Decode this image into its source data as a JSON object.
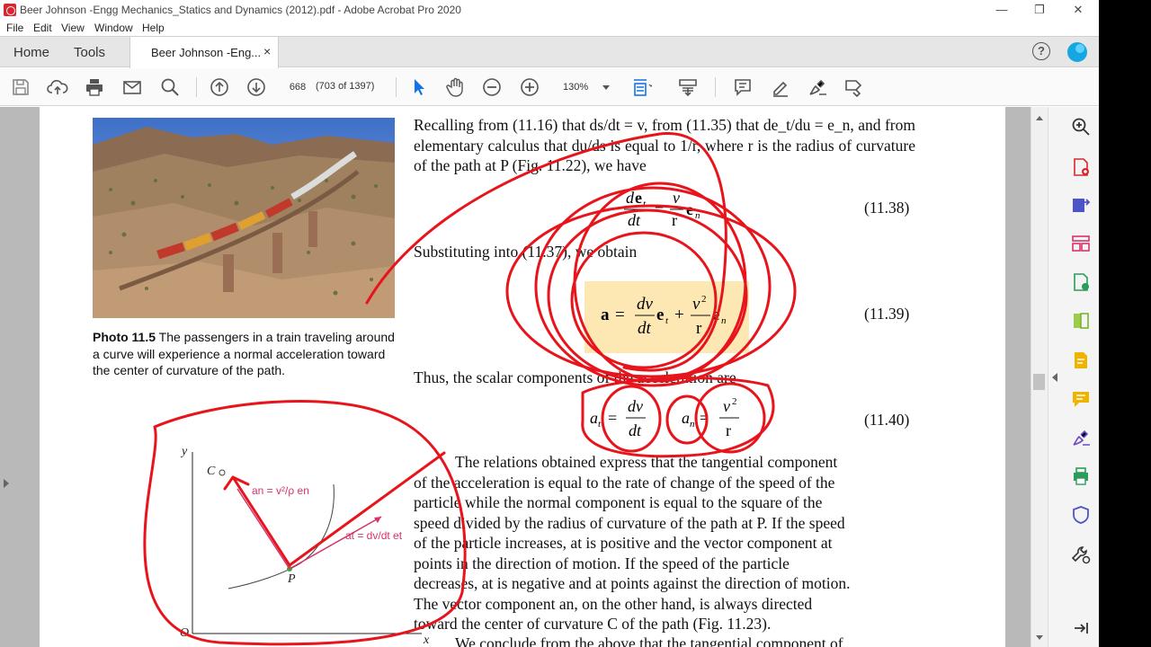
{
  "window": {
    "title": "Beer Johnson -Engg Mechanics_Statics and Dynamics (2012).pdf - Adobe Acrobat Pro 2020",
    "minimize": "—",
    "maximize": "❐",
    "close": "✕"
  },
  "menu": [
    "File",
    "Edit",
    "View",
    "Window",
    "Help"
  ],
  "tabs": {
    "home": "Home",
    "tools": "Tools",
    "document": "Beer Johnson -Eng...",
    "close": "×"
  },
  "toolbar": {
    "page_number": "668",
    "page_count": "(703 of 1397)",
    "zoom": "130%",
    "icons": [
      "save-icon",
      "upload-icon",
      "print-icon",
      "email-icon",
      "search-icon",
      "previous-page-icon",
      "next-page-icon",
      "zoom-out-icon",
      "zoom-in-icon",
      "select-cursor-icon",
      "hand-tool-icon",
      "fit-page-icon",
      "scroll-mode-icon",
      "comment-icon",
      "highlight-pen-icon",
      "sign-icon",
      "redact-icon"
    ]
  },
  "right_pane_icons": [
    "zoom-icon",
    "create-pdf-icon",
    "export-pdf-icon",
    "organize-pages-icon",
    "edit-pdf-icon",
    "combine-files-icon",
    "create-pdf-alt-icon",
    "comment-icon",
    "fill-sign-icon",
    "print-production-icon",
    "protect-icon",
    "more-tools-icon",
    "expand-icon"
  ],
  "page": {
    "caption_bold": "Photo 11.5",
    "caption_text": "The passengers in a train traveling around a curve will experience a normal acceleration toward the center of curvature of the path.",
    "para1": "Recalling from (11.16) that ds/dt = v, from (11.35) that de_t/du = e_n, and from elementary calculus that du/ds is equal to 1/r, where r is the radius of curvature of the path at P (Fig. 11.22), we have",
    "eq1_num": "(11.38)",
    "para2": "Substituting into (11.37), we obtain",
    "eq2_num": "(11.39)",
    "para3": "Thus, the scalar components of the acceleration are",
    "eq3_num": "(11.40)",
    "para4_lines": [
      "The relations obtained express that the tangential component",
      "of the acceleration is equal to the rate of change of the speed of the",
      "particle while the normal component is equal to the square of the",
      "speed divided by the radius of curvature of the path at P. If the speed",
      "of the particle increases, at is positive and the vector component at",
      "points in the direction of motion. If the speed of the particle",
      "decreases, at is negative and at points against the direction of motion.",
      "The vector component an, on the other hand, is always directed",
      "toward the center of curvature C of the path (Fig. 11.23)."
    ],
    "para5": "We conclude from the above that the tangential component of",
    "figure": {
      "axis_y": "y",
      "axis_x": "x",
      "origin": "O",
      "point_c": "C",
      "point_p": "P",
      "an_label": "an = v²/ρ en",
      "at_label": "at = dv/dt et"
    }
  },
  "colors": {
    "annotation_red": "#e8141b",
    "highlight": "#fde8b3",
    "figure_magenta": "#d6336c",
    "accent_blue": "#1473e6"
  }
}
